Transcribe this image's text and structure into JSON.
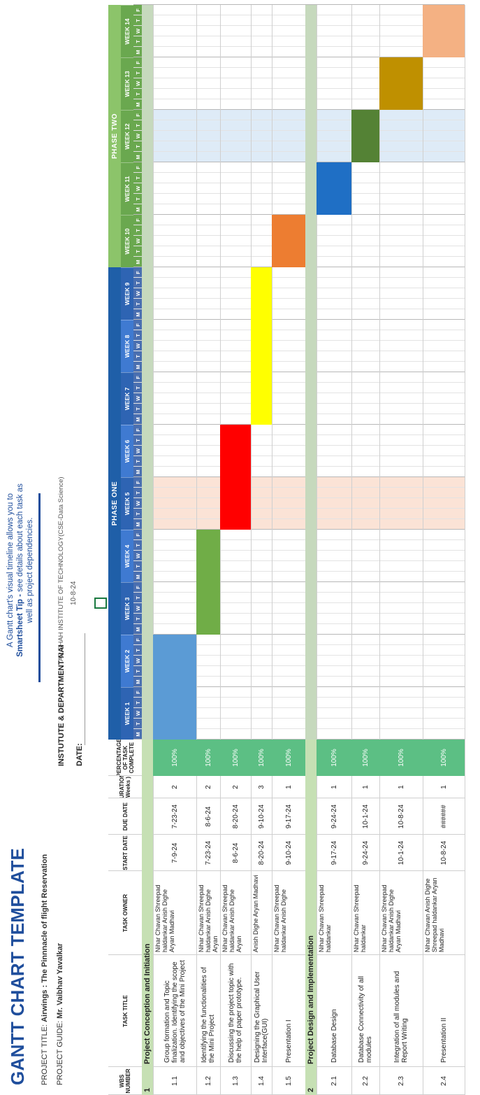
{
  "header": {
    "title": "GANTT CHART TEMPLATE",
    "project_title_label": "PROJECT TITLE:",
    "project_title_value": "Airwings : The Pinnnacle of flight Reservation",
    "project_guide_label": "PROJECT GUIDE:",
    "project_guide_value": "Mr. Vaibhav Yavalkar",
    "tip_prefix": "Smartsheet Tip -",
    "tip_line1": "A Gantt chart's visual timeline allows you to",
    "tip_line2": "see details about each task as well as project dependencies.",
    "institute_label": "INSTUTUTE & DEPARTMENT NAI",
    "institute_value": "AP SHAH INSTITUTE OF TECHNOLOGY(CSE-Data Science)",
    "date_label": "DATE:",
    "date_value": "10-8-24"
  },
  "columns": {
    "wbs": "WBS NUMBER",
    "task_title": "TASK TITLE",
    "task_owner": "TASK OWNER",
    "start_date": "START DATE",
    "due_date": "DUE DATE",
    "duration": "DURATION( Weeks )",
    "percent": "PERCENTAGE OF TASK COMPLETE"
  },
  "phases": [
    {
      "label": "PHASE ONE",
      "color": "#1f5fa8"
    },
    {
      "label": "PHASE TWO",
      "color": "#8cc46a"
    }
  ],
  "weeks": [
    "WEEK 1",
    "WEEK 2",
    "WEEK 3",
    "WEEK 4",
    "WEEK 5",
    "WEEK 6",
    "WEEK 7",
    "WEEK 8",
    "WEEK 9",
    "WEEK 10",
    "WEEK 11",
    "WEEK 12",
    "WEEK 13",
    "WEEK 14"
  ],
  "days": [
    "M",
    "T",
    "W",
    "T",
    "F"
  ],
  "sections": [
    {
      "num": "1",
      "title": "Project Conception and Initiation",
      "color": "#c6e0b4"
    },
    {
      "num": "2",
      "title": "Project Design and Implementation",
      "color": "#c6e0b4"
    }
  ],
  "tasks": [
    {
      "wbs": "1.1",
      "title": "Group formation and Topic finalization. Identifying the scope and objectives of the Mini Project",
      "owner": "Nihar Chavan Shreepad haldankar Anish Dighe Aryan Madhavi",
      "start": "7-9-24",
      "due": "7-23-24",
      "duration": "2",
      "percent": "100%",
      "bar_start_week": 1,
      "bar_weeks": 2,
      "bar_color": "#5b9bd5"
    },
    {
      "wbs": "1.2",
      "title": "Identifying the functionalities of the Mini Project",
      "owner": "Nihar Chavan Shreepad haldankar Anish Dighe Aryan",
      "start": "7-23-24",
      "due": "8-6-24",
      "duration": "2",
      "percent": "100%",
      "bar_start_week": 3,
      "bar_weeks": 2,
      "bar_color": "#70ad47"
    },
    {
      "wbs": "1.3",
      "title": "Discussing the project topic with the help of paper prototype.",
      "owner": "Nihar Chavan Shreepad haldankar Anish Dighe Aryan",
      "start": "8-6-24",
      "due": "8-20-24",
      "duration": "2",
      "percent": "100%",
      "bar_start_week": 5,
      "bar_weeks": 2,
      "bar_color": "#ff0000"
    },
    {
      "wbs": "1.4",
      "title": "Designing the Graphical User Interface(GUI)",
      "owner": "Anish Dighe Aryan Madhavi",
      "start": "8-20-24",
      "due": "9-10-24",
      "duration": "3",
      "percent": "100%",
      "bar_start_week": 7,
      "bar_weeks": 3,
      "bar_color": "#ffff00"
    },
    {
      "wbs": "1.5",
      "title": "Presentation I",
      "owner": "Nihar Chavan Shreepad haldankar Anish Dighe",
      "start": "9-10-24",
      "due": "9-17-24",
      "duration": "1",
      "percent": "100%",
      "bar_start_week": 10,
      "bar_weeks": 1,
      "bar_color": "#ed7d31"
    },
    {
      "wbs": "2.1",
      "title": "Database Design",
      "owner": "Nihar Chavan Shreepad haldankar",
      "start": "9-17-24",
      "due": "9-24-24",
      "duration": "1",
      "percent": "100%",
      "bar_start_week": 11,
      "bar_weeks": 1,
      "bar_color": "#1f6fc5"
    },
    {
      "wbs": "2.2",
      "title": "Database Connectivity of all modules",
      "owner": "Nihar Chavan Shreepad haldankar",
      "start": "9-24-24",
      "due": "10-1-24",
      "duration": "1",
      "percent": "100%",
      "bar_start_week": 12,
      "bar_weeks": 1,
      "bar_color": "#548235"
    },
    {
      "wbs": "2.3",
      "title": "Integration of all modules and Report Writing",
      "owner": "Nihar Chavan Shreepad haldankar Anish Dighe Aryan Madhavi",
      "start": "10-1-24",
      "due": "10-8-24",
      "duration": "1",
      "percent": "100%",
      "bar_start_week": 13,
      "bar_weeks": 1,
      "bar_color": "#bf9000"
    },
    {
      "wbs": "2.4",
      "title": "Presentation II",
      "owner": "Nihar Chavan Anish Dighe Shreepad haldankar Aryan Madhavi",
      "start": "10-8-24",
      "due": "######",
      "duration": "1",
      "percent": "100%",
      "bar_start_week": 14,
      "bar_weeks": 1,
      "bar_color": "#f4b183"
    }
  ],
  "colors": {
    "percent_fill": "#5cbf84",
    "week_header_1": "#2e64b3",
    "week_header_2": "#3f7ad1",
    "week_header_green": "#6aa84f",
    "day_header_blue": "#4a6fb0",
    "day_header_green": "#6aa84f",
    "shade_pink": "#fbe3d6",
    "shade_blue": "#deebf7",
    "section_divider": "#c6d9bd",
    "title_blue": "#1f4e9c"
  }
}
